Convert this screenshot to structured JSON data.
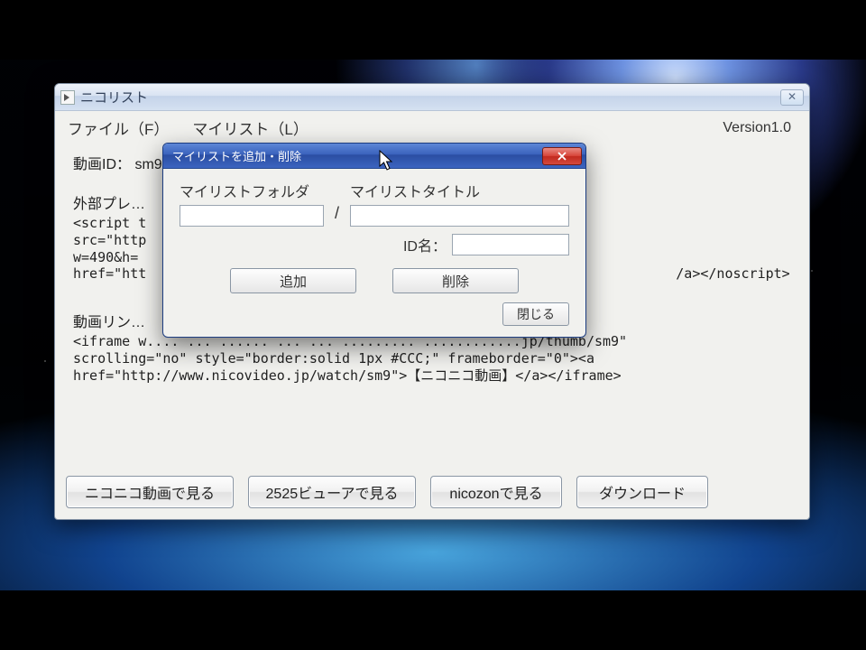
{
  "window": {
    "title": "ニコリスト",
    "menu": {
      "file": "ファイル（F）",
      "mylist": "マイリスト（L）"
    },
    "version": "Version1.0"
  },
  "main": {
    "video_id_label": "動画ID：",
    "video_id_value": "sm9",
    "ext_player_label": "外部プレ…",
    "ext_player_code": "<script t\nsrc=\"http\nw=490&h=\nhref=\"htt                                                                 /a></noscript>",
    "video_link_label": "動画リン…",
    "video_link_code": "<iframe w.... ... ...... ... ... ......... ............jp/thumb/sm9\"\nscrolling=\"no\" style=\"border:solid 1px #CCC;\" frameborder=\"0\"><a\nhref=\"http://www.nicovideo.jp/watch/sm9\">【ニコニコ動画】</a></iframe>"
  },
  "buttons": {
    "niconico": "ニコニコ動画で見る",
    "viewer2525": "2525ビューアで見る",
    "nicozon": "nicozonで見る",
    "download": "ダウンロード"
  },
  "dialog": {
    "title": "マイリストを追加・削除",
    "folder_label": "マイリストフォルダ",
    "title_label": "マイリストタイトル",
    "folder_value": "",
    "title_value": "",
    "id_label": "ID名：",
    "id_value": "",
    "add": "追加",
    "delete": "削除",
    "close": "閉じる"
  }
}
